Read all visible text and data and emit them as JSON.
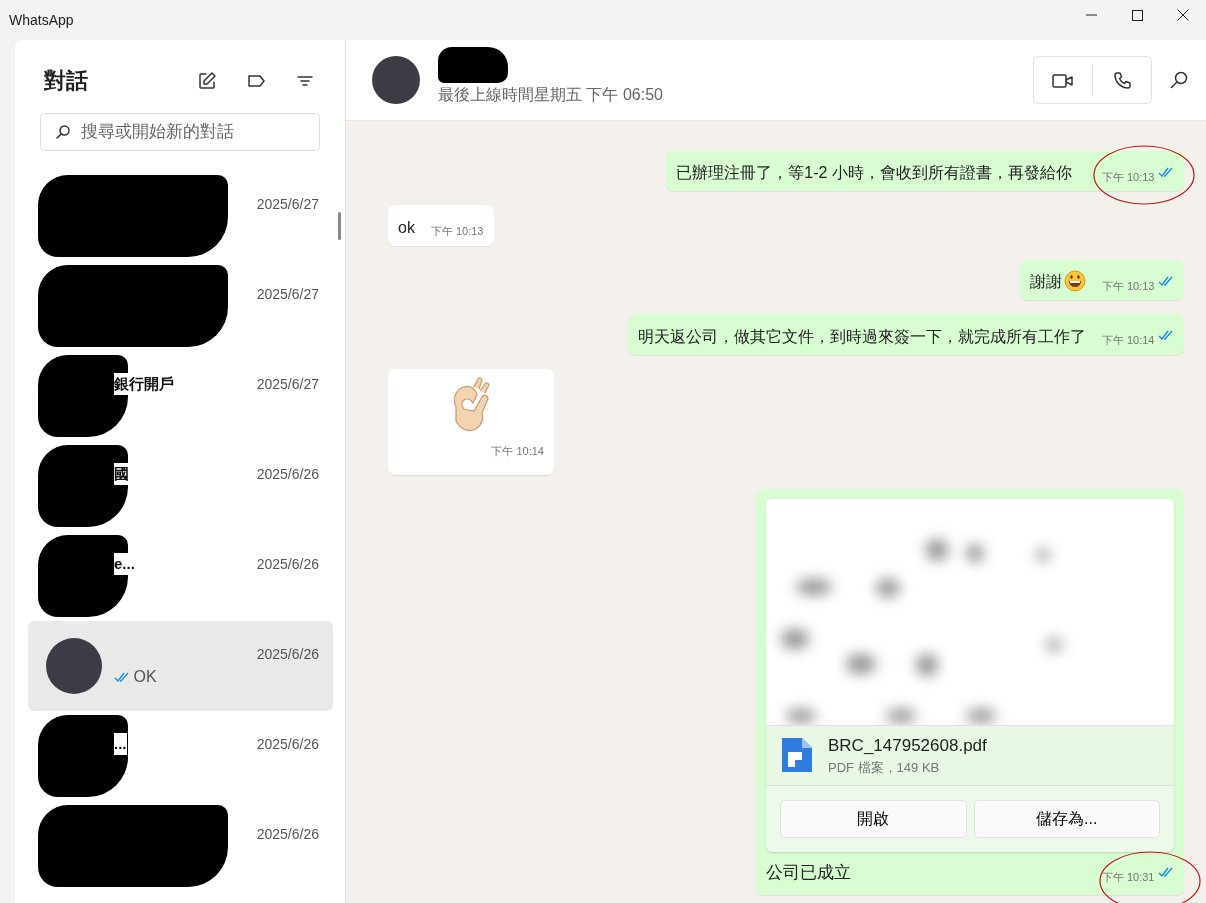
{
  "window": {
    "title": "WhatsApp"
  },
  "sidebar": {
    "title": "對話",
    "search": {
      "placeholder": "搜尋或開始新的對話"
    },
    "chats": [
      {
        "date": "2025/6/27",
        "selected": false,
        "redacted": true
      },
      {
        "date": "2025/6/27",
        "selected": false,
        "redacted": true
      },
      {
        "name": "銀行開戶",
        "date": "2025/6/27",
        "selected": false,
        "redacted": true
      },
      {
        "name": "國",
        "date": "2025/6/26",
        "selected": false,
        "redacted": true
      },
      {
        "name": "e...",
        "date": "2025/6/26",
        "selected": false,
        "redacted": true
      },
      {
        "date": "2025/6/26",
        "preview": "OK",
        "read": true,
        "selected": true,
        "redacted": false
      },
      {
        "name": "...",
        "date": "2025/6/26",
        "selected": false,
        "redacted": true
      },
      {
        "date": "2025/6/26",
        "selected": false,
        "redacted": true
      }
    ]
  },
  "chat": {
    "status": "最後上線時間星期五 下午 06:50",
    "messages": [
      {
        "kind": "text",
        "outgoing": true,
        "text": "已辦理注冊了，等1-2 小時，會收到所有證書，再發給你",
        "time": "下午 10:13",
        "read": true,
        "annotated": true
      },
      {
        "kind": "text",
        "outgoing": false,
        "text": "ok",
        "time": "下午 10:13"
      },
      {
        "kind": "text",
        "outgoing": true,
        "text": "謝謝",
        "emoji": true,
        "time": "下午 10:13",
        "read": true
      },
      {
        "kind": "text",
        "outgoing": true,
        "text": "明天返公司，做其它文件，到時過來簽一下，就完成所有工作了",
        "time": "下午 10:14",
        "read": true
      },
      {
        "kind": "sticker",
        "outgoing": false,
        "time": "下午 10:14"
      },
      {
        "kind": "document",
        "outgoing": true,
        "file": "BRC_147952608.pdf",
        "meta": "PDF 檔案，149 KB",
        "buttons": [
          "開啟",
          "儲存為..."
        ],
        "text": "公司已成立",
        "time": "下午 10:31",
        "read": true,
        "annotated": true
      }
    ]
  }
}
